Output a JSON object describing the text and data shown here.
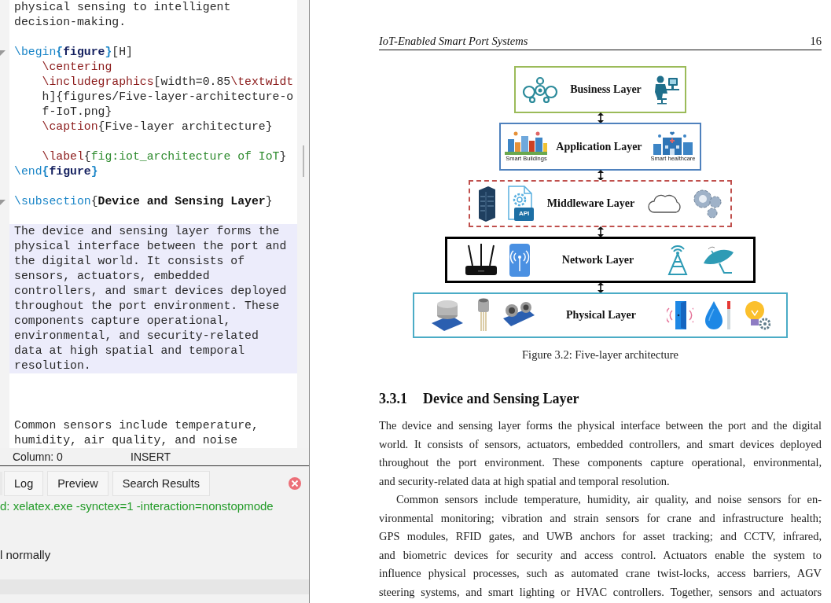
{
  "editor": {
    "lines": [
      {
        "highlighted": false,
        "segments": [
          {
            "kind": "plain",
            "text": "physical sensing to intelligent"
          }
        ]
      },
      {
        "highlighted": false,
        "segments": [
          {
            "kind": "plain",
            "text": "decision-making."
          }
        ]
      },
      {
        "highlighted": false
      },
      {
        "highlighted": false,
        "fold": true,
        "segments": [
          {
            "kind": "keyword",
            "text": "\\begin"
          },
          {
            "kind": "brace",
            "text": "{"
          },
          {
            "kind": "env",
            "text": "figure"
          },
          {
            "kind": "brace",
            "text": "}"
          },
          {
            "kind": "plain",
            "text": "[H]"
          }
        ]
      },
      {
        "highlighted": false,
        "indented": true,
        "segments": [
          {
            "kind": "command",
            "text": "\\centering"
          }
        ]
      },
      {
        "highlighted": false,
        "indented": true,
        "segments": [
          {
            "kind": "command",
            "text": "\\includegraphics"
          },
          {
            "kind": "plain",
            "text": "[width=0.85"
          },
          {
            "kind": "command",
            "text": "\\textwidt"
          }
        ]
      },
      {
        "highlighted": false,
        "indented": true,
        "segments": [
          {
            "kind": "plain",
            "text": "h]{figures/Five-layer-architecture-o"
          }
        ]
      },
      {
        "highlighted": false,
        "indented": true,
        "segments": [
          {
            "kind": "plain",
            "text": "f-IoT.png}"
          }
        ]
      },
      {
        "highlighted": false,
        "indented": true,
        "segments": [
          {
            "kind": "command",
            "text": "\\caption"
          },
          {
            "kind": "plain",
            "text": "{Five-layer architecture}"
          }
        ]
      },
      {
        "highlighted": false
      },
      {
        "highlighted": false,
        "indented": true,
        "segments": [
          {
            "kind": "command",
            "text": "\\label"
          },
          {
            "kind": "plain",
            "text": "{"
          },
          {
            "kind": "label",
            "text": "fig:iot_architecture of IoT"
          },
          {
            "kind": "plain",
            "text": "}"
          }
        ]
      },
      {
        "highlighted": false,
        "segments": [
          {
            "kind": "keyword",
            "text": "\\end"
          },
          {
            "kind": "brace",
            "text": "{"
          },
          {
            "kind": "env",
            "text": "figure"
          },
          {
            "kind": "brace",
            "text": "}"
          }
        ]
      },
      {
        "highlighted": false
      },
      {
        "highlighted": false,
        "fold": true,
        "segments": [
          {
            "kind": "keyword",
            "text": "\\subsection"
          },
          {
            "kind": "plain",
            "text": "{"
          },
          {
            "kind": "heading",
            "text": "Device and Sensing Layer"
          },
          {
            "kind": "plain",
            "text": "}"
          }
        ]
      },
      {
        "highlighted": false
      },
      {
        "highlighted": true,
        "segments": [
          {
            "kind": "plain",
            "text": "The device and sensing layer forms the"
          }
        ]
      },
      {
        "highlighted": true,
        "segments": [
          {
            "kind": "plain",
            "text": "physical interface between the port and"
          }
        ]
      },
      {
        "highlighted": true,
        "segments": [
          {
            "kind": "plain",
            "text": "the digital world. It consists of"
          }
        ]
      },
      {
        "highlighted": true,
        "segments": [
          {
            "kind": "plain",
            "text": "sensors, actuators, embedded"
          }
        ]
      },
      {
        "highlighted": true,
        "segments": [
          {
            "kind": "plain",
            "text": "controllers, and smart devices deployed"
          }
        ]
      },
      {
        "highlighted": true,
        "segments": [
          {
            "kind": "plain",
            "text": "throughout the port environment. These"
          }
        ]
      },
      {
        "highlighted": true,
        "segments": [
          {
            "kind": "plain",
            "text": "components capture operational,"
          }
        ]
      },
      {
        "highlighted": true,
        "segments": [
          {
            "kind": "plain",
            "text": "environmental, and security-related"
          }
        ]
      },
      {
        "highlighted": true,
        "segments": [
          {
            "kind": "plain",
            "text": "data at high spatial and temporal"
          }
        ]
      },
      {
        "highlighted": true,
        "segments": [
          {
            "kind": "plain",
            "text": "resolution."
          }
        ]
      },
      {
        "highlighted": false
      },
      {
        "highlighted": false
      },
      {
        "highlighted": false
      },
      {
        "highlighted": false,
        "segments": [
          {
            "kind": "plain",
            "text": "Common sensors include temperature,"
          }
        ]
      },
      {
        "highlighted": false,
        "segments": [
          {
            "kind": "plain",
            "text": "humidity, air quality, and noise"
          }
        ]
      }
    ]
  },
  "status_bar": {
    "column": "Column: 0",
    "mode": "INSERT"
  },
  "output_panel": {
    "tabs": [
      {
        "label": "Log",
        "selected": false
      },
      {
        "label": "Preview",
        "selected": false
      },
      {
        "label": "Search Results",
        "selected": false
      }
    ],
    "log_lines": [
      {
        "kind": "command",
        "text": "d: xelatex.exe -synctex=1 -interaction=nonstopmode"
      },
      {
        "kind": "blank"
      },
      {
        "kind": "blank"
      },
      {
        "kind": "info",
        "text": "l normally"
      }
    ]
  },
  "pdf": {
    "header_title": "IoT-Enabled Smart Port Systems",
    "page_number": "16",
    "figure": {
      "layers": [
        {
          "label": "Business Layer",
          "color": "#9bbb59",
          "kind": "solid"
        },
        {
          "label": "Application Layer",
          "color": "#4f81bd",
          "kind": "solid",
          "captions": [
            "Smart Buildings",
            "Smart healthcare"
          ]
        },
        {
          "label": "Middleware Layer",
          "color": "#c0504d",
          "kind": "dashed",
          "badge": "API"
        },
        {
          "label": "Network Layer",
          "color": "#000000",
          "kind": "thick"
        },
        {
          "label": "Physical Layer",
          "color": "#4bacc6",
          "kind": "solid"
        }
      ],
      "caption": "Figure 3.2: Five-layer architecture"
    },
    "section": {
      "number": "3.3.1",
      "title": "Device and Sensing Layer"
    },
    "paragraphs": [
      {
        "indent": false,
        "lines": [
          "The device and sensing layer forms the physical interface between the port and the digital",
          "world. It consists of sensors, actuators, embedded controllers, and smart devices deployed",
          "throughout the port environment. These components capture operational, environmental,",
          "and security-related data at high spatial and temporal resolution."
        ],
        "ends": true
      },
      {
        "indent": true,
        "lines": [
          "Common sensors include temperature, humidity, air quality, and noise sensors for en-",
          "vironmental monitoring; vibration and strain sensors for crane and infrastructure health;",
          "GPS modules, RFID gates, and UWB anchors for asset tracking; and CCTV, infrared,",
          "and biometric devices for security and access control. Actuators enable the system to",
          "influence physical processes, such as automated crane twist-locks, access barriers, AGV",
          "steering systems, and smart lighting or HVAC controllers. Together, sensors and actuators"
        ],
        "ends": false
      }
    ]
  }
}
